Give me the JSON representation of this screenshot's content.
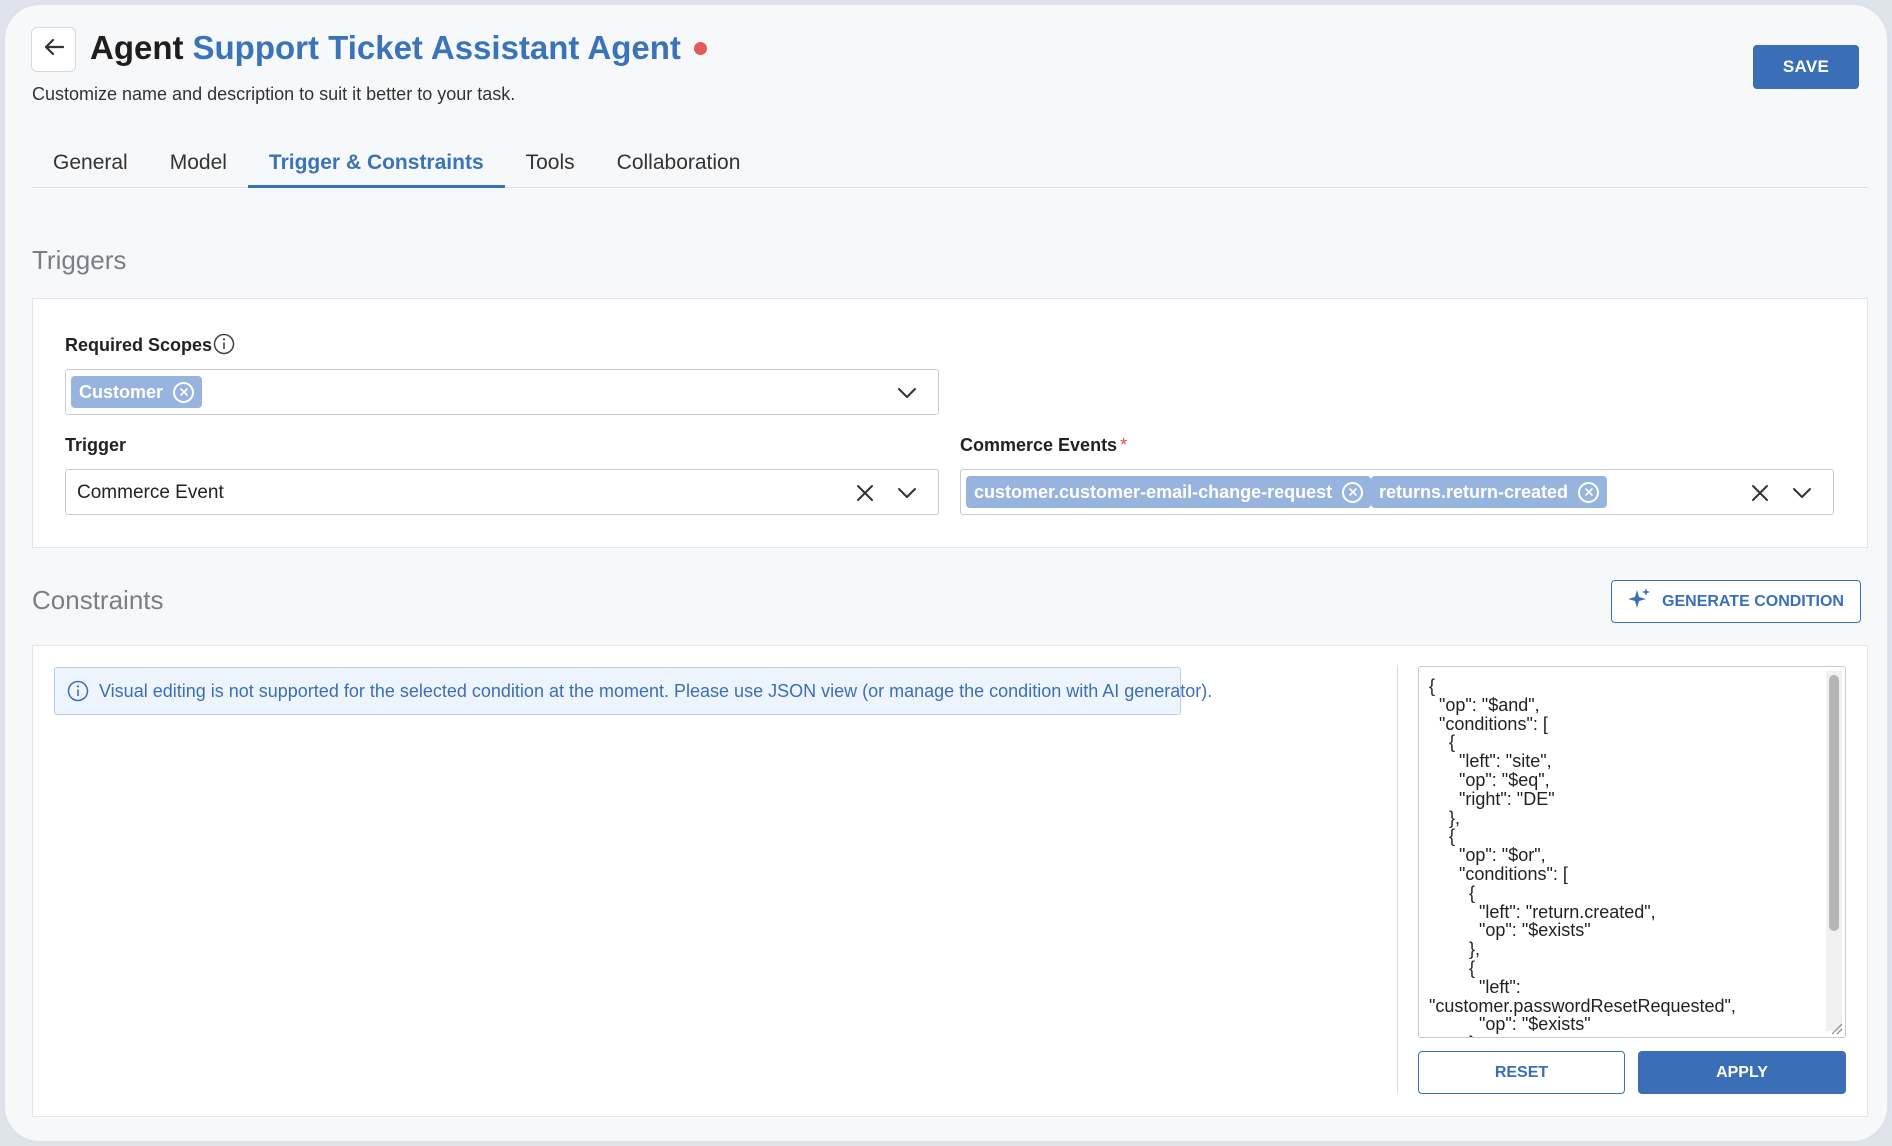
{
  "header": {
    "title_prefix": "Agent",
    "agent_name": "Support Ticket Assistant Agent",
    "subtitle": "Customize name and description to suit it better to your task.",
    "save_label": "SAVE",
    "status_dot_color": "#e25b57"
  },
  "tabs": [
    {
      "label": "General",
      "active": false
    },
    {
      "label": "Model",
      "active": false
    },
    {
      "label": "Trigger & Constraints",
      "active": true
    },
    {
      "label": "Tools",
      "active": false
    },
    {
      "label": "Collaboration",
      "active": false
    }
  ],
  "triggers": {
    "section_title": "Triggers",
    "required_scopes": {
      "label": "Required Scopes",
      "chips": [
        "Customer"
      ]
    },
    "trigger": {
      "label": "Trigger",
      "value": "Commerce Event"
    },
    "commerce_events": {
      "label": "Commerce Events",
      "required_mark": "*",
      "chips": [
        "customer.customer-email-change-request",
        "returns.return-created"
      ]
    }
  },
  "constraints": {
    "section_title": "Constraints",
    "generate_label": "GENERATE CONDITION",
    "info_text": "Visual editing is not supported for the selected condition at the moment. Please use JSON view (or manage the condition with AI generator).",
    "json_text": "{\n  \"op\": \"$and\",\n  \"conditions\": [\n    {\n      \"left\": \"site\",\n      \"op\": \"$eq\",\n      \"right\": \"DE\"\n    },\n    {\n      \"op\": \"$or\",\n      \"conditions\": [\n        {\n          \"left\": \"return.created\",\n          \"op\": \"$exists\"\n        },\n        {\n          \"left\":\n\"customer.passwordResetRequested\",\n          \"op\": \"$exists\"\n        }",
    "reset_label": "RESET",
    "apply_label": "APPLY"
  },
  "colors": {
    "accent": "#3a6fb8",
    "chip": "#97b4de",
    "required": "#e04848"
  }
}
